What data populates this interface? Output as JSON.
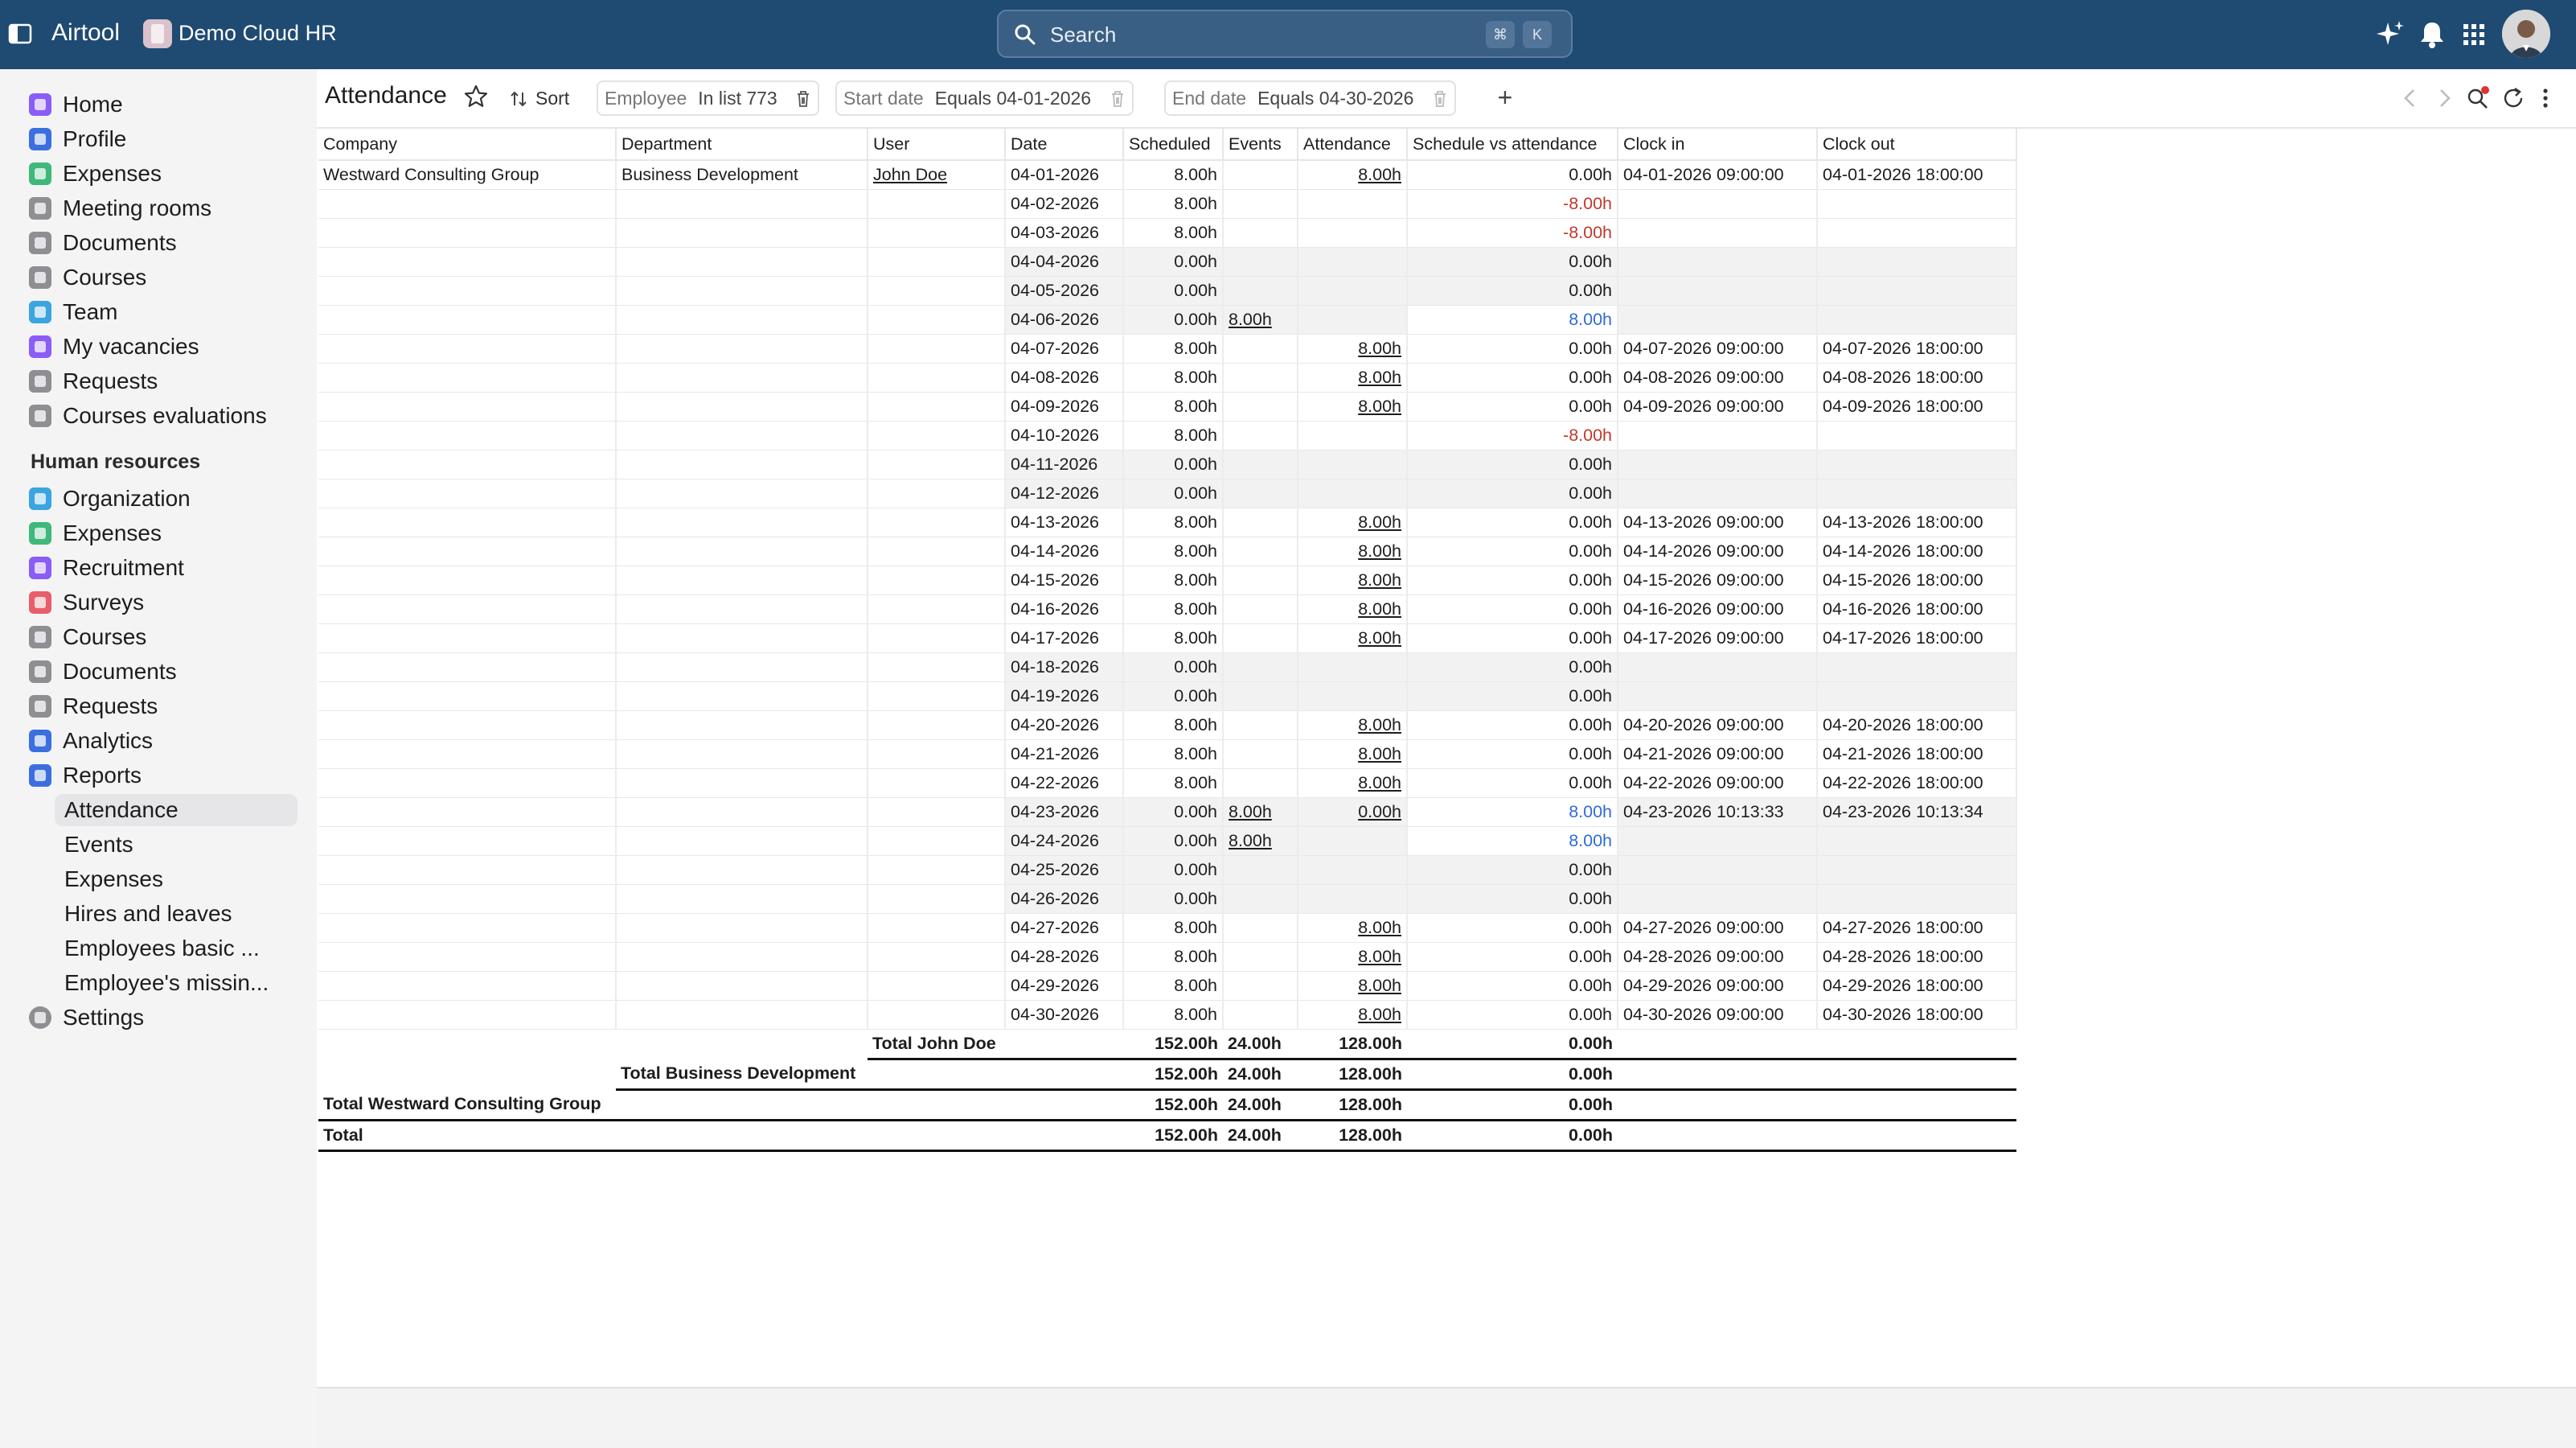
{
  "app": {
    "name": "Airtool",
    "workspace": "Demo Cloud HR"
  },
  "search": {
    "placeholder": "Search",
    "kbd1": "⌘",
    "kbd2": "K"
  },
  "sidebar": {
    "main_items": [
      {
        "label": "Home",
        "color": "#8b5cf6"
      },
      {
        "label": "Profile",
        "color": "#3b6fe0"
      },
      {
        "label": "Expenses",
        "color": "#3fb87a"
      },
      {
        "label": "Meeting rooms",
        "color": "#8e8e93"
      },
      {
        "label": "Documents",
        "color": "#8e8e93"
      },
      {
        "label": "Courses",
        "color": "#8e8e93"
      },
      {
        "label": "Team",
        "color": "#3aa5e0"
      },
      {
        "label": "My vacancies",
        "color": "#8b5cf6"
      },
      {
        "label": "Requests",
        "color": "#8e8e93"
      },
      {
        "label": "Courses evaluations",
        "color": "#8e8e93"
      }
    ],
    "section_title": "Human resources",
    "hr_items": [
      {
        "label": "Organization",
        "color": "#3aa5e0"
      },
      {
        "label": "Expenses",
        "color": "#3fb87a"
      },
      {
        "label": "Recruitment",
        "color": "#8b5cf6"
      },
      {
        "label": "Surveys",
        "color": "#e85d6a"
      },
      {
        "label": "Courses",
        "color": "#8e8e93"
      },
      {
        "label": "Documents",
        "color": "#8e8e93"
      },
      {
        "label": "Requests",
        "color": "#8e8e93"
      },
      {
        "label": "Analytics",
        "color": "#3b6fe0"
      },
      {
        "label": "Reports",
        "color": "#3b6fe0"
      }
    ],
    "report_items": [
      "Attendance",
      "Events",
      "Expenses",
      "Hires and leaves",
      "Employees basic ...",
      "Employee's missin..."
    ],
    "settings": {
      "label": "Settings",
      "color": "#8e8e93"
    }
  },
  "toolbar": {
    "title": "Attendance",
    "sort_label": "Sort",
    "filters": [
      {
        "key": "Employee",
        "value": "In list 773"
      },
      {
        "key": "Start date",
        "value": "Equals 04-01-2026"
      },
      {
        "key": "End date",
        "value": "Equals 04-30-2026"
      }
    ],
    "add_label": "+"
  },
  "table": {
    "columns": [
      "Company",
      "Department",
      "User",
      "Date",
      "Scheduled",
      "Events",
      "Attendance",
      "Schedule vs attendance",
      "Clock in",
      "Clock out"
    ],
    "company": "Westward Consulting Group",
    "department": "Business Development",
    "user": "John Doe",
    "rows": [
      {
        "date": "04-01-2026",
        "scheduled": "8.00h",
        "events": "",
        "attendance": "8.00h",
        "svsa": "0.00h",
        "in": "04-01-2026 09:00:00",
        "out": "04-01-2026 18:00:00",
        "wk": false
      },
      {
        "date": "04-02-2026",
        "scheduled": "8.00h",
        "events": "",
        "attendance": "",
        "svsa": "-8.00h",
        "in": "",
        "out": "",
        "wk": false
      },
      {
        "date": "04-03-2026",
        "scheduled": "8.00h",
        "events": "",
        "attendance": "",
        "svsa": "-8.00h",
        "in": "",
        "out": "",
        "wk": false
      },
      {
        "date": "04-04-2026",
        "scheduled": "0.00h",
        "events": "",
        "attendance": "",
        "svsa": "0.00h",
        "in": "",
        "out": "",
        "wk": true
      },
      {
        "date": "04-05-2026",
        "scheduled": "0.00h",
        "events": "",
        "attendance": "",
        "svsa": "0.00h",
        "in": "",
        "out": "",
        "wk": true
      },
      {
        "date": "04-06-2026",
        "scheduled": "0.00h",
        "events": "8.00h",
        "attendance": "",
        "svsa": "8.00h",
        "in": "",
        "out": "",
        "wk": true
      },
      {
        "date": "04-07-2026",
        "scheduled": "8.00h",
        "events": "",
        "attendance": "8.00h",
        "svsa": "0.00h",
        "in": "04-07-2026 09:00:00",
        "out": "04-07-2026 18:00:00",
        "wk": false
      },
      {
        "date": "04-08-2026",
        "scheduled": "8.00h",
        "events": "",
        "attendance": "8.00h",
        "svsa": "0.00h",
        "in": "04-08-2026 09:00:00",
        "out": "04-08-2026 18:00:00",
        "wk": false
      },
      {
        "date": "04-09-2026",
        "scheduled": "8.00h",
        "events": "",
        "attendance": "8.00h",
        "svsa": "0.00h",
        "in": "04-09-2026 09:00:00",
        "out": "04-09-2026 18:00:00",
        "wk": false
      },
      {
        "date": "04-10-2026",
        "scheduled": "8.00h",
        "events": "",
        "attendance": "",
        "svsa": "-8.00h",
        "in": "",
        "out": "",
        "wk": false
      },
      {
        "date": "04-11-2026",
        "scheduled": "0.00h",
        "events": "",
        "attendance": "",
        "svsa": "0.00h",
        "in": "",
        "out": "",
        "wk": true
      },
      {
        "date": "04-12-2026",
        "scheduled": "0.00h",
        "events": "",
        "attendance": "",
        "svsa": "0.00h",
        "in": "",
        "out": "",
        "wk": true
      },
      {
        "date": "04-13-2026",
        "scheduled": "8.00h",
        "events": "",
        "attendance": "8.00h",
        "svsa": "0.00h",
        "in": "04-13-2026 09:00:00",
        "out": "04-13-2026 18:00:00",
        "wk": false
      },
      {
        "date": "04-14-2026",
        "scheduled": "8.00h",
        "events": "",
        "attendance": "8.00h",
        "svsa": "0.00h",
        "in": "04-14-2026 09:00:00",
        "out": "04-14-2026 18:00:00",
        "wk": false
      },
      {
        "date": "04-15-2026",
        "scheduled": "8.00h",
        "events": "",
        "attendance": "8.00h",
        "svsa": "0.00h",
        "in": "04-15-2026 09:00:00",
        "out": "04-15-2026 18:00:00",
        "wk": false
      },
      {
        "date": "04-16-2026",
        "scheduled": "8.00h",
        "events": "",
        "attendance": "8.00h",
        "svsa": "0.00h",
        "in": "04-16-2026 09:00:00",
        "out": "04-16-2026 18:00:00",
        "wk": false
      },
      {
        "date": "04-17-2026",
        "scheduled": "8.00h",
        "events": "",
        "attendance": "8.00h",
        "svsa": "0.00h",
        "in": "04-17-2026 09:00:00",
        "out": "04-17-2026 18:00:00",
        "wk": false
      },
      {
        "date": "04-18-2026",
        "scheduled": "0.00h",
        "events": "",
        "attendance": "",
        "svsa": "0.00h",
        "in": "",
        "out": "",
        "wk": true
      },
      {
        "date": "04-19-2026",
        "scheduled": "0.00h",
        "events": "",
        "attendance": "",
        "svsa": "0.00h",
        "in": "",
        "out": "",
        "wk": true
      },
      {
        "date": "04-20-2026",
        "scheduled": "8.00h",
        "events": "",
        "attendance": "8.00h",
        "svsa": "0.00h",
        "in": "04-20-2026 09:00:00",
        "out": "04-20-2026 18:00:00",
        "wk": false
      },
      {
        "date": "04-21-2026",
        "scheduled": "8.00h",
        "events": "",
        "attendance": "8.00h",
        "svsa": "0.00h",
        "in": "04-21-2026 09:00:00",
        "out": "04-21-2026 18:00:00",
        "wk": false
      },
      {
        "date": "04-22-2026",
        "scheduled": "8.00h",
        "events": "",
        "attendance": "8.00h",
        "svsa": "0.00h",
        "in": "04-22-2026 09:00:00",
        "out": "04-22-2026 18:00:00",
        "wk": false
      },
      {
        "date": "04-23-2026",
        "scheduled": "0.00h",
        "events": "8.00h",
        "attendance": "0.00h",
        "svsa": "8.00h",
        "in": "04-23-2026 10:13:33",
        "out": "04-23-2026 10:13:34",
        "wk": true
      },
      {
        "date": "04-24-2026",
        "scheduled": "0.00h",
        "events": "8.00h",
        "attendance": "",
        "svsa": "8.00h",
        "in": "",
        "out": "",
        "wk": true
      },
      {
        "date": "04-25-2026",
        "scheduled": "0.00h",
        "events": "",
        "attendance": "",
        "svsa": "0.00h",
        "in": "",
        "out": "",
        "wk": true
      },
      {
        "date": "04-26-2026",
        "scheduled": "0.00h",
        "events": "",
        "attendance": "",
        "svsa": "0.00h",
        "in": "",
        "out": "",
        "wk": true
      },
      {
        "date": "04-27-2026",
        "scheduled": "8.00h",
        "events": "",
        "attendance": "8.00h",
        "svsa": "0.00h",
        "in": "04-27-2026 09:00:00",
        "out": "04-27-2026 18:00:00",
        "wk": false
      },
      {
        "date": "04-28-2026",
        "scheduled": "8.00h",
        "events": "",
        "attendance": "8.00h",
        "svsa": "0.00h",
        "in": "04-28-2026 09:00:00",
        "out": "04-28-2026 18:00:00",
        "wk": false
      },
      {
        "date": "04-29-2026",
        "scheduled": "8.00h",
        "events": "",
        "attendance": "8.00h",
        "svsa": "0.00h",
        "in": "04-29-2026 09:00:00",
        "out": "04-29-2026 18:00:00",
        "wk": false
      },
      {
        "date": "04-30-2026",
        "scheduled": "8.00h",
        "events": "",
        "attendance": "8.00h",
        "svsa": "0.00h",
        "in": "04-30-2026 09:00:00",
        "out": "04-30-2026 18:00:00",
        "wk": false
      }
    ],
    "totals": [
      {
        "label": "Total John Doe",
        "level": "user",
        "scheduled": "152.00h",
        "events": "24.00h",
        "attendance": "128.00h",
        "svsa": "0.00h"
      },
      {
        "label": "Total Business Development",
        "level": "department",
        "scheduled": "152.00h",
        "events": "24.00h",
        "attendance": "128.00h",
        "svsa": "0.00h"
      },
      {
        "label": "Total Westward Consulting Group",
        "level": "company",
        "scheduled": "152.00h",
        "events": "24.00h",
        "attendance": "128.00h",
        "svsa": "0.00h"
      },
      {
        "label": "Total",
        "level": "grand",
        "scheduled": "152.00h",
        "events": "24.00h",
        "attendance": "128.00h",
        "svsa": "0.00h"
      }
    ]
  },
  "colors": {
    "topbar": "#1f4a72",
    "negative": "#c0392b",
    "positive": "#2f6bd6"
  }
}
